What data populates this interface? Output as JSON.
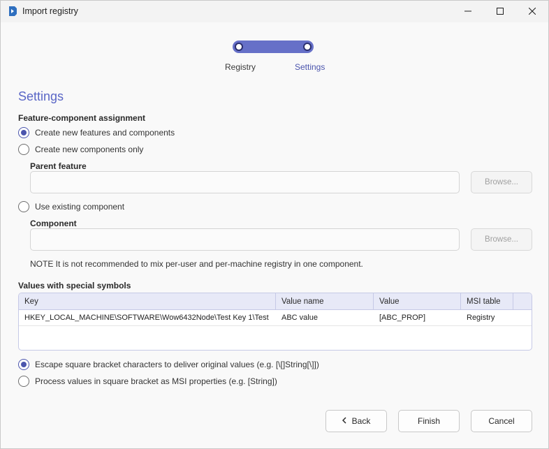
{
  "window": {
    "title": "Import registry"
  },
  "stepper": {
    "steps": [
      {
        "label": "Registry"
      },
      {
        "label": "Settings"
      }
    ]
  },
  "settings": {
    "title": "Settings",
    "assignment_label": "Feature-component assignment",
    "options": [
      {
        "label": "Create new features and components",
        "checked": true
      },
      {
        "label": "Create new components only",
        "checked": false
      },
      {
        "label": "Use existing component",
        "checked": false
      }
    ],
    "parent_feature": {
      "label": "Parent feature",
      "value": "",
      "browse_label": "Browse..."
    },
    "component": {
      "label": "Component",
      "value": "",
      "browse_label": "Browse..."
    },
    "note": "NOTE It is not recommended to mix per-user and per-machine registry in one component."
  },
  "special_values": {
    "label": "Values with special symbols",
    "columns": [
      "Key",
      "Value name",
      "Value",
      "MSI table"
    ],
    "rows": [
      [
        "HKEY_LOCAL_MACHINE\\SOFTWARE\\Wow6432Node\\Test Key 1\\Test",
        "ABC value",
        "[ABC_PROP]",
        "Registry"
      ]
    ]
  },
  "bracket_options": [
    {
      "label": "Escape square bracket characters to deliver original values (e.g. [\\[]String[\\]])",
      "checked": true
    },
    {
      "label": "Process values in square bracket as MSI properties (e.g. [String])",
      "checked": false
    }
  ],
  "footer": {
    "back_label": "Back",
    "finish_label": "Finish",
    "cancel_label": "Cancel"
  },
  "colors": {
    "accent": "#5a66c6",
    "stepper": "#6670c8"
  }
}
